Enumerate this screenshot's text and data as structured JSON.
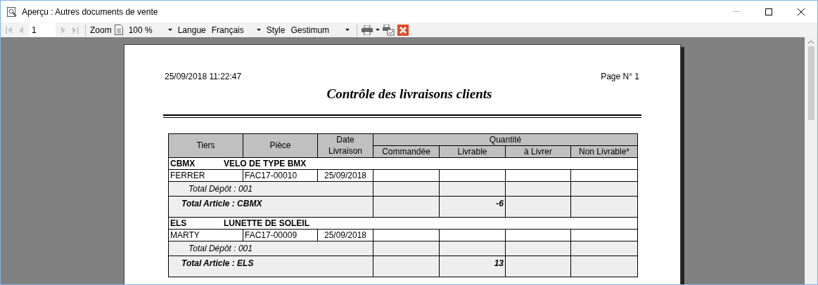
{
  "window": {
    "title": "Aperçu : Autres documents de vente"
  },
  "toolbar": {
    "page": "1",
    "zoom_label": "Zoom",
    "zoom": "100 %",
    "language_label": "Langue",
    "language": "Français",
    "style_label": "Style",
    "style": "Gestimum"
  },
  "report": {
    "datetime": "25/09/2018 11:22:47",
    "page": "Page N° 1",
    "title": "Contrôle des livraisons clients",
    "columns": {
      "tiers": "Tiers",
      "piece": "Pièce",
      "date": "Date Livraison",
      "quantity": "Quantité",
      "sub": [
        "Commandée",
        "Livrable",
        "à Livrer",
        "Non Livrable*"
      ]
    },
    "lines": [
      {
        "kind": "group",
        "code": "CBMX",
        "label": "VELO DE TYPE BMX"
      },
      {
        "kind": "detail",
        "tiers": "FERRER",
        "piece": "FAC17-00010",
        "date": "25/09/2018"
      },
      {
        "kind": "depot",
        "label": "Total Dépôt : 001"
      },
      {
        "kind": "article",
        "label": "Total Article : CBMX",
        "livrable": "-6"
      },
      {
        "kind": "group",
        "code": "ELS",
        "label": "LUNETTE DE SOLEIL"
      },
      {
        "kind": "detail",
        "tiers": "MARTY",
        "piece": "FAC17-00009",
        "date": "25/09/2018"
      },
      {
        "kind": "depot",
        "label": "Total Dépôt : 001"
      },
      {
        "kind": "article",
        "label": "Total Article : ELS",
        "livrable": "13"
      }
    ]
  }
}
